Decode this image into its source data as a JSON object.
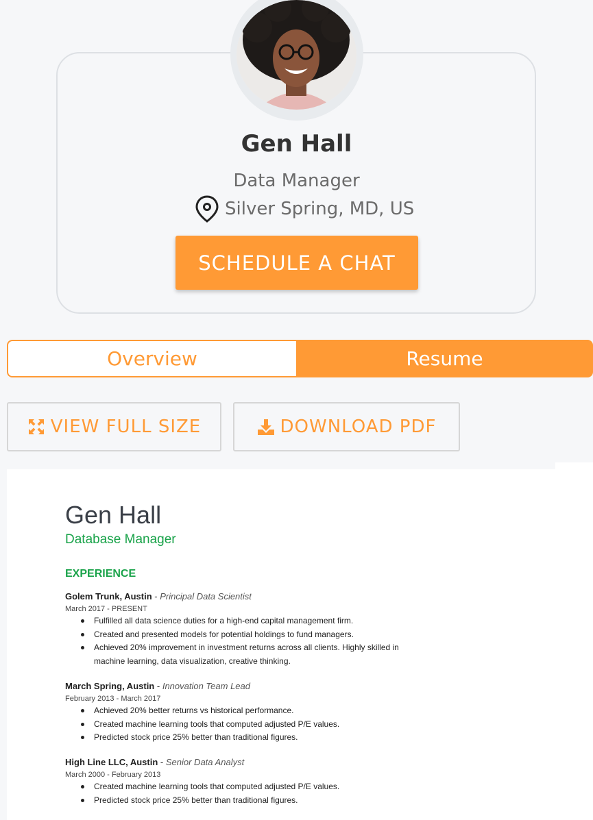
{
  "profile": {
    "name": "Gen Hall",
    "title": "Data Manager",
    "location": "Silver Spring, MD, US",
    "schedule_label": "SCHEDULE A CHAT"
  },
  "tabs": [
    {
      "label": "Overview",
      "active": false
    },
    {
      "label": "Resume",
      "active": true
    }
  ],
  "actions": {
    "view_full_size": "VIEW FULL SIZE",
    "download_pdf": "DOWNLOAD PDF"
  },
  "resume": {
    "name": "Gen Hall",
    "role": "Database Manager",
    "section_title": "EXPERIENCE",
    "jobs": [
      {
        "company": "Golem Trunk,  Austin",
        "position": "Principal Data Scientist",
        "dates": "March 2017 - PRESENT",
        "bullets": [
          "Fulfilled all data science duties for a high-end capital management firm.",
          "Created and presented models for potential holdings to fund managers.",
          "Achieved 20% improvement in investment returns across all clients. Highly skilled in machine learning, data visualization, creative thinking."
        ]
      },
      {
        "company": "March Spring, Austin",
        "position": "Innovation Team Lead",
        "dates": "February 2013 - March 2017",
        "bullets": [
          "Achieved 20% better returns vs historical performance.",
          "Created machine learning tools that computed adjusted P/E values.",
          "Predicted stock price 25% better than traditional figures."
        ]
      },
      {
        "company": "High Line LLC, Austin",
        "position": "Senior Data Analyst",
        "dates": "March 2000 - February 2013",
        "bullets": [
          "Created machine learning tools that computed adjusted P/E values.",
          "Predicted stock price 25% better than traditional figures."
        ]
      }
    ]
  },
  "colors": {
    "accent": "#ff9a35",
    "resume_green": "#1aa34a"
  }
}
